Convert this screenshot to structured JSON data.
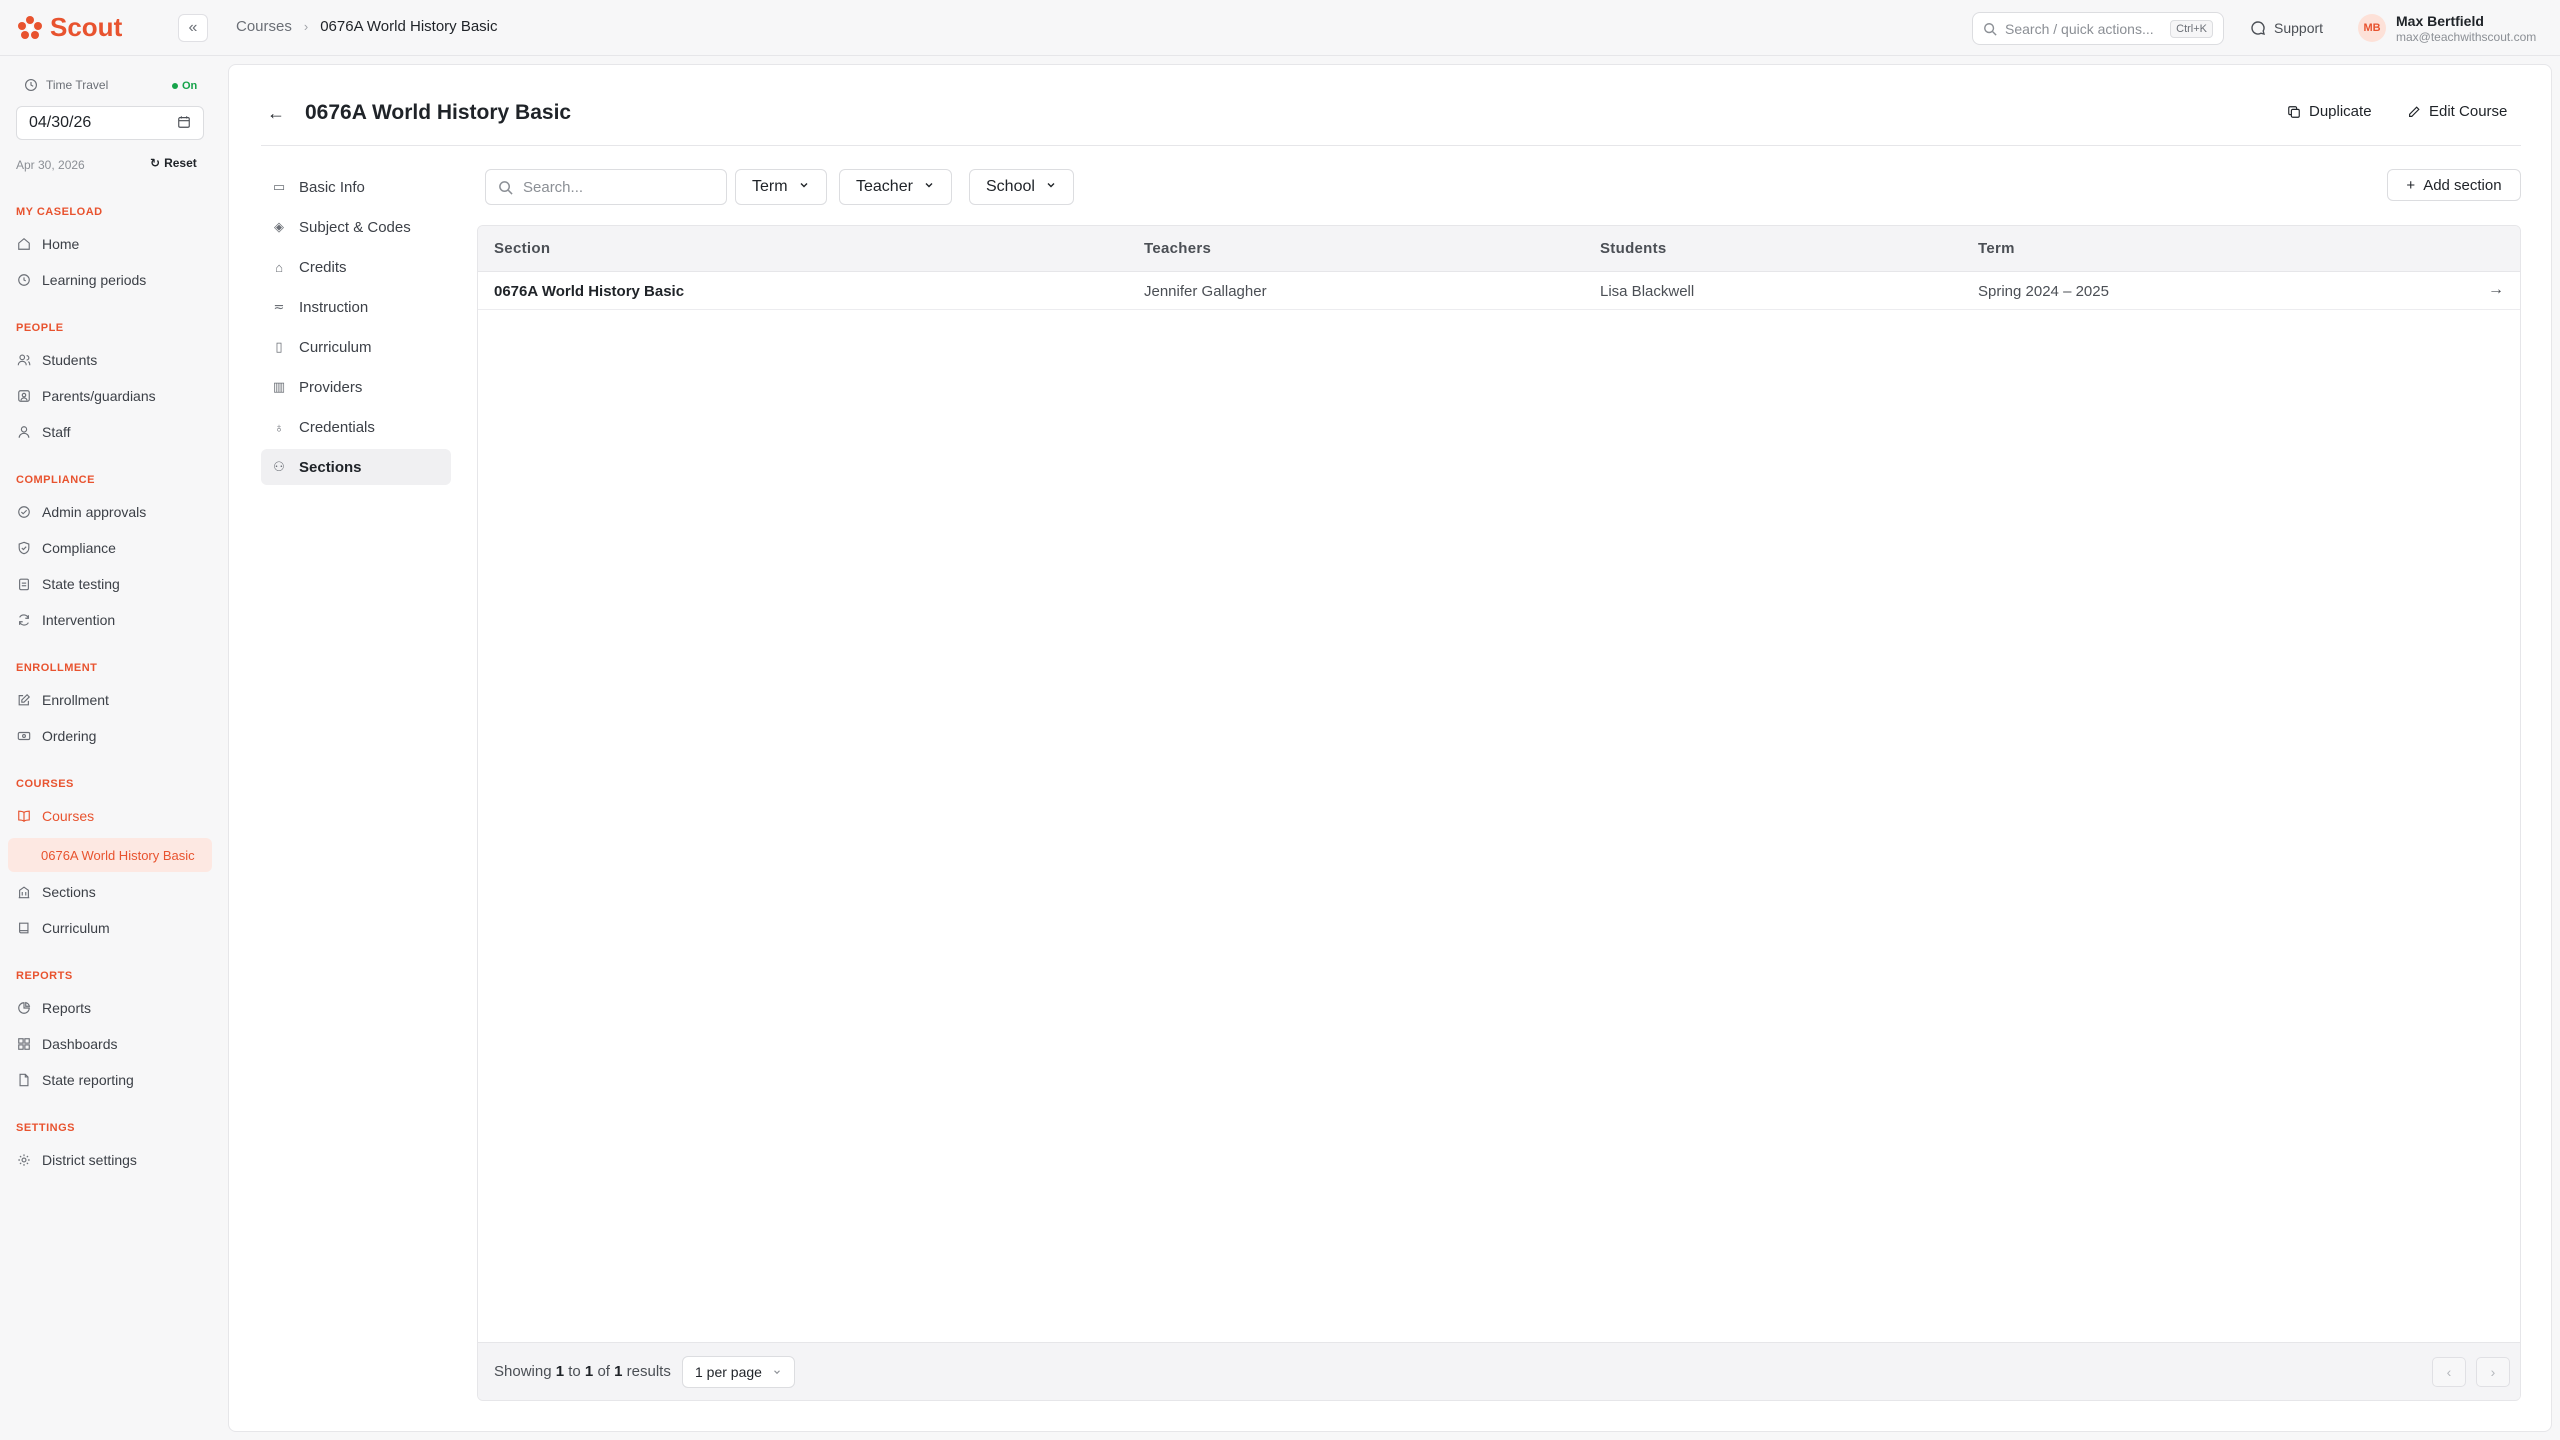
{
  "app": {
    "name": "Scout"
  },
  "breadcrumb": [
    "Courses",
    "0676A World History Basic"
  ],
  "topbar": {
    "search_placeholder": "Search / quick actions...",
    "search_shortcut": "Ctrl+K",
    "support_label": "Support",
    "user_initials": "MB",
    "user_name": "Max Bertfield",
    "user_email": "max@teachwithscout.com"
  },
  "time_travel": {
    "label": "Time Travel",
    "status": "On",
    "date_value": "04/30/26",
    "date_display": "Apr 30, 2026",
    "reset_label": "Reset"
  },
  "sidebar": {
    "sections": [
      {
        "heading": "MY CASELOAD",
        "items": [
          "Home",
          "Learning periods"
        ]
      },
      {
        "heading": "PEOPLE",
        "items": [
          "Students",
          "Parents/guardians",
          "Staff"
        ]
      },
      {
        "heading": "COMPLIANCE",
        "items": [
          "Admin approvals",
          "Compliance",
          "State testing",
          "Intervention"
        ]
      },
      {
        "heading": "ENROLLMENT",
        "items": [
          "Enrollment",
          "Ordering"
        ]
      },
      {
        "heading": "COURSES",
        "items": [
          "Courses",
          "0676A World History Basic",
          "Sections",
          "Curriculum"
        ]
      },
      {
        "heading": "REPORTS",
        "items": [
          "Reports",
          "Dashboards",
          "State reporting"
        ]
      },
      {
        "heading": "SETTINGS",
        "items": [
          "District settings"
        ]
      }
    ]
  },
  "page": {
    "title": "0676A World History Basic",
    "duplicate_label": "Duplicate",
    "edit_label": "Edit Course"
  },
  "subnav": [
    "Basic Info",
    "Subject & Codes",
    "Credits",
    "Instruction",
    "Curriculum",
    "Providers",
    "Credentials",
    "Sections"
  ],
  "filters": {
    "search_placeholder": "Search...",
    "term_label": "Term",
    "teacher_label": "Teacher",
    "school_label": "School",
    "add_section_label": "Add section"
  },
  "table": {
    "columns": [
      "Section",
      "Teachers",
      "Students",
      "Term"
    ],
    "rows": [
      {
        "section": "0676A World History Basic",
        "teachers": "Jennifer Gallagher",
        "students": "Lisa Blackwell",
        "term": "Spring 2024 – 2025"
      }
    ]
  },
  "pagination": {
    "showing_prefix": "Showing",
    "from": "1",
    "to_word": "to",
    "to": "1",
    "of_word": "of",
    "total": "1",
    "results_word": "results",
    "per_page_label": "1 per page"
  },
  "colors": {
    "accent": "#e8532f",
    "active_bg": "#fde8e2",
    "status_on": "#16a34a"
  }
}
